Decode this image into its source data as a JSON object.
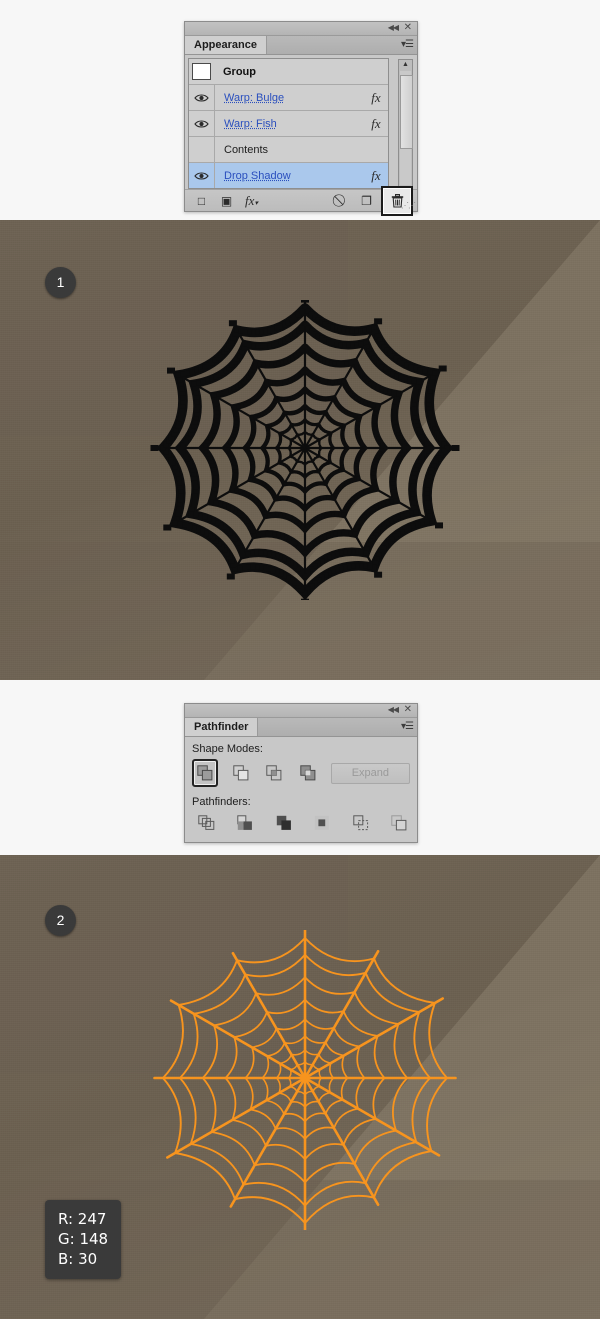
{
  "appearance_panel": {
    "title_tab": "Appearance",
    "collapse_icon": "double-chevron-left-icon",
    "close_icon": "close-icon",
    "menu_icon": "panel-menu-icon",
    "rows": [
      {
        "type": "swatch",
        "label": "Group",
        "eye": false,
        "fx": false,
        "selected": false
      },
      {
        "type": "effect",
        "label": "Warp: Bulge",
        "eye": true,
        "fx": true,
        "selected": false
      },
      {
        "type": "effect",
        "label": "Warp: Fish",
        "eye": true,
        "fx": true,
        "selected": false
      },
      {
        "type": "plain",
        "label": "Contents",
        "eye": false,
        "fx": false,
        "selected": false
      },
      {
        "type": "effect",
        "label": "Drop Shadow",
        "eye": true,
        "fx": true,
        "selected": true
      }
    ],
    "footer": {
      "new_stroke_label": "□",
      "new_fill_label": "▣",
      "add_effect_label": "fx",
      "clear_appearance_label": "⃠",
      "duplicate_label": "❐",
      "delete_label": "🗑",
      "delete_name": "trash-icon"
    },
    "scrollbar": {
      "up": "▲",
      "down": "▼"
    }
  },
  "pathfinder_panel": {
    "title_tab": "Pathfinder",
    "collapse_icon": "double-chevron-left-icon",
    "close_icon": "close-icon",
    "menu_icon": "panel-menu-icon",
    "shape_modes_label": "Shape Modes:",
    "pathfinders_label": "Pathfinders:",
    "expand_label": "Expand",
    "expand_enabled": false,
    "shape_modes": [
      {
        "name": "unite",
        "active": true
      },
      {
        "name": "minus-front",
        "active": false
      },
      {
        "name": "intersect",
        "active": false
      },
      {
        "name": "exclude",
        "active": false
      }
    ],
    "pathfinders": [
      {
        "name": "divide"
      },
      {
        "name": "trim"
      },
      {
        "name": "merge"
      },
      {
        "name": "crop"
      },
      {
        "name": "outline"
      },
      {
        "name": "minus-back"
      }
    ]
  },
  "step1": {
    "badge": "1",
    "web_color": "#0d0d0d",
    "web_style": "anchor-points-visible"
  },
  "step2": {
    "badge": "2",
    "web_color": "#F7941E",
    "rgb": {
      "r_label": "R: 247",
      "g_label": "G: 148",
      "b_label": "B: 30"
    }
  },
  "colors": {
    "accent_orange": "#F7941E",
    "backdrop_dark": "#6b6050",
    "backdrop_light": "#8a7f6e",
    "badge_bg": "#3a3a3a",
    "panel_bg": "#c8c8c8",
    "link_blue": "#2a4fbe",
    "row_selected": "#aac8ec"
  }
}
